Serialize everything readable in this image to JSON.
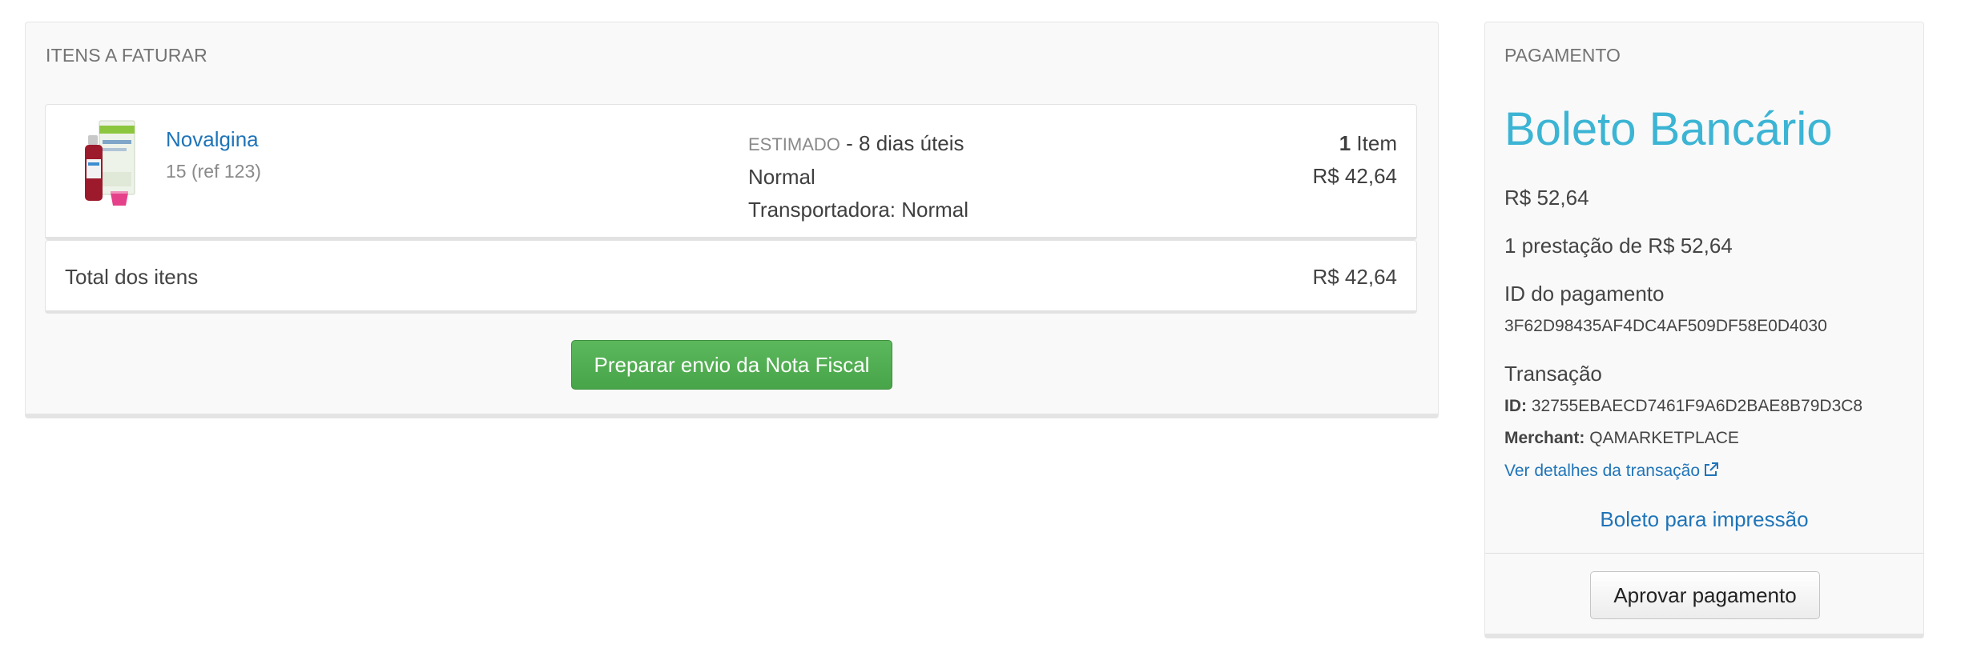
{
  "items_panel": {
    "heading": "ITENS A FATURAR",
    "item": {
      "name": "Novalgina",
      "ref": "15 (ref 123)",
      "estimate_label": "ESTIMADO",
      "estimate_value": " - 8 dias úteis",
      "shipping_method": "Normal",
      "carrier": "Transportadora: Normal",
      "quantity": "1",
      "quantity_unit": " Item",
      "price": "R$ 42,64"
    },
    "total_label": "Total dos itens",
    "total_value": "R$ 42,64",
    "prepare_button": "Preparar envio da Nota Fiscal"
  },
  "payment_panel": {
    "heading": "PAGAMENTO",
    "method": "Boleto Bancário",
    "amount": "R$ 52,64",
    "installments": "1 prestação de R$ 52,64",
    "payment_id_label": "ID do pagamento",
    "payment_id": "3F62D98435AF4DC4AF509DF58E0D4030",
    "transaction_label": "Transação",
    "transaction_id_label": "ID:",
    "transaction_id": " 32755EBAECD7461F9A6D2BAE8B79D3C8",
    "merchant_label": "Merchant:",
    "merchant": " QAMARKETPLACE",
    "details_link": "Ver detalhes da transação",
    "print_link": "Boleto para impressão",
    "approve_button": "Aprovar pagamento"
  },
  "colors": {
    "link": "#1f74b8",
    "method_title": "#3cb4d4",
    "primary_button": "#5cb85c"
  },
  "icons": {
    "external_link": "external-link-icon"
  }
}
